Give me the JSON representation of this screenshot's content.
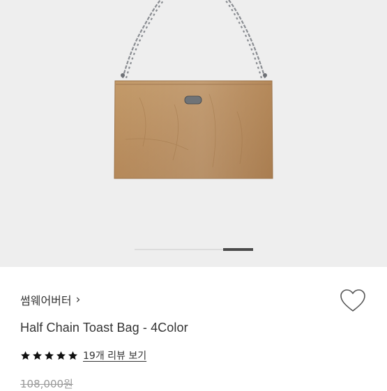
{
  "product": {
    "brand": "썸웨어버터",
    "title": "Half Chain Toast Bag - 4Color",
    "rating_value": 5,
    "rating_max": 5,
    "review_link": "19개 리뷰 보기",
    "original_price": "108,000원"
  },
  "gallery": {
    "current_slide_fraction_start": 0.75,
    "current_slide_fraction_end": 1.0
  },
  "icons": {
    "brand_chevron": "chevron-right-icon",
    "wishlist": "heart-outline-icon",
    "star": "star-filled-icon"
  },
  "colors": {
    "gallery_bg": "#eeeeee",
    "bag_leather": "#b98e5f",
    "star": "#111111",
    "price_strike": "#9a9a9a"
  }
}
